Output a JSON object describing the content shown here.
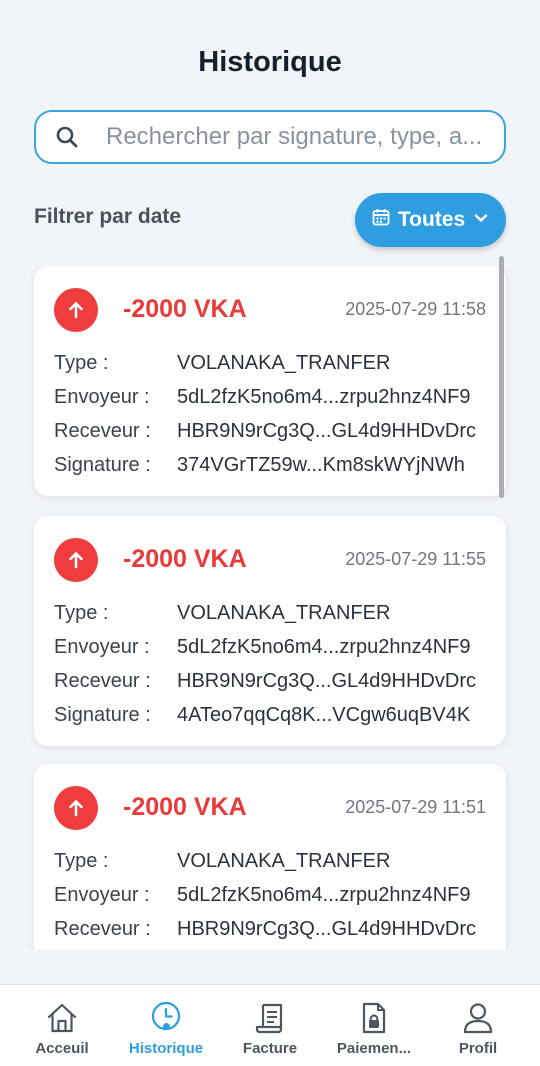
{
  "header": {
    "title": "Historique"
  },
  "search": {
    "placeholder": "Rechercher par signature, type, a..."
  },
  "filter": {
    "label": "Filtrer par date",
    "button_label": "Toutes"
  },
  "field_labels": {
    "type": "Type :",
    "sender": "Envoyeur :",
    "receiver": "Receveur :",
    "signature": "Signature :"
  },
  "transactions": [
    {
      "amount": "-2000 VKA",
      "datetime": "2025-07-29 11:58",
      "type": "VOLANAKA_TRANFER",
      "sender": "5dL2fzK5no6m4...zrpu2hnz4NF9",
      "receiver": "HBR9N9rCg3Q...GL4d9HHDvDrc",
      "signature": "374VGrTZ59w...Km8skWYjNWh"
    },
    {
      "amount": "-2000 VKA",
      "datetime": "2025-07-29 11:55",
      "type": "VOLANAKA_TRANFER",
      "sender": "5dL2fzK5no6m4...zrpu2hnz4NF9",
      "receiver": "HBR9N9rCg3Q...GL4d9HHDvDrc",
      "signature": "4ATeo7qqCq8K...VCgw6uqBV4K"
    },
    {
      "amount": "-2000 VKA",
      "datetime": "2025-07-29 11:51",
      "type": "VOLANAKA_TRANFER",
      "sender": "5dL2fzK5no6m4...zrpu2hnz4NF9",
      "receiver": "HBR9N9rCg3Q...GL4d9HHDvDrc",
      "signature": ""
    }
  ],
  "nav": {
    "items": [
      {
        "label": "Acceuil",
        "icon": "home-icon"
      },
      {
        "label": "Historique",
        "icon": "clock-icon",
        "active": true
      },
      {
        "label": "Facture",
        "icon": "receipt-icon"
      },
      {
        "label": "Paiemen...",
        "icon": "payment-document-icon"
      },
      {
        "label": "Profil",
        "icon": "user-icon"
      }
    ]
  },
  "colors": {
    "accent": "#2f9ee0",
    "debit": "#e83b3b",
    "background": "#f1f4f8"
  }
}
